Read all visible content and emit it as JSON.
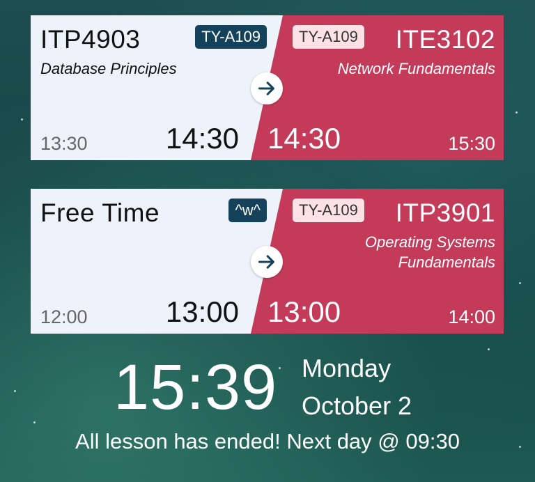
{
  "current_lesson": {
    "code": "ITP4903",
    "subject": "Database Principles",
    "room": "TY-A109",
    "start": "13:30",
    "end": "14:30"
  },
  "next_lesson": {
    "code": "ITE3102",
    "subject": "Network Fundamentals",
    "room": "TY-A109",
    "start": "14:30",
    "end": "15:30"
  },
  "free_slot": {
    "title": "Free Time",
    "badge": "^w^",
    "start": "12:00",
    "end": "13:00"
  },
  "after_free_lesson": {
    "code": "ITP3901",
    "subject_line1": "Operating Systems",
    "subject_line2": "Fundamentals",
    "room": "TY-A109",
    "start": "13:00",
    "end": "14:00"
  },
  "clock": {
    "time": "15:39",
    "weekday": "Monday",
    "date": "October 2",
    "status": "All lesson has ended! Next day @ 09:30"
  },
  "colors": {
    "current_bg": "#eef2fb",
    "next_bg": "#c43b5a",
    "room_badge_dark": "#14425a",
    "room_badge_light": "#fce1e6",
    "arrow": "#14425a"
  }
}
